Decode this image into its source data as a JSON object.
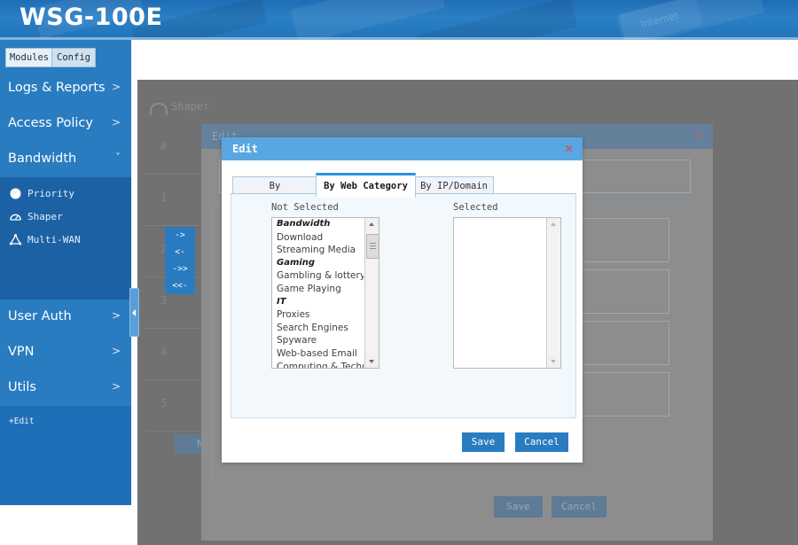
{
  "banner": {
    "product_title": "WSG-100E",
    "key_texture_label": "Internet"
  },
  "sidebar": {
    "tabs": [
      {
        "label": "Modules",
        "name": "tab-modules"
      },
      {
        "label": "Config",
        "name": "tab-config"
      }
    ],
    "items": [
      {
        "label": "Logs & Reports",
        "arrow": ">"
      },
      {
        "label": "Access Policy",
        "arrow": ">"
      },
      {
        "label": "Bandwidth",
        "arrow": "ˇ"
      },
      {
        "label": "User Auth",
        "arrow": ">"
      },
      {
        "label": "VPN",
        "arrow": ">"
      },
      {
        "label": "Utils",
        "arrow": ">"
      }
    ],
    "subitems": [
      {
        "label": "Priority",
        "icon": "circle-icon"
      },
      {
        "label": "Shaper",
        "icon": "gauge-icon"
      },
      {
        "label": "Multi-WAN",
        "icon": "network-triangle-icon"
      }
    ],
    "edit_link": "+Edit",
    "collapse_icon": "chevron-left-icon"
  },
  "background_page": {
    "title": "Shaper",
    "title_icon": "gauge-icon",
    "table_rows": [
      "#",
      "1",
      "2",
      "3",
      "4",
      "5"
    ],
    "new_button": "New"
  },
  "background_modal": {
    "title": "Edit",
    "close_icon": "close-icon",
    "save_label": "Save",
    "cancel_label": "Cancel"
  },
  "modal": {
    "title": "Edit",
    "close_icon": "close-icon",
    "tabs": [
      {
        "label": "By Applications",
        "active": false
      },
      {
        "label": "By Web Category",
        "active": true
      },
      {
        "label": "By IP/Domain",
        "active": false
      }
    ],
    "not_selected_label": "Not Selected",
    "selected_label": "Selected",
    "not_selected_items": [
      {
        "text": "Bandwidth",
        "group": true
      },
      {
        "text": "Download",
        "group": false
      },
      {
        "text": "Streaming Media",
        "group": false
      },
      {
        "text": "Gaming",
        "group": true
      },
      {
        "text": "Gambling & lottery",
        "group": false
      },
      {
        "text": "Game Playing",
        "group": false
      },
      {
        "text": "IT",
        "group": true
      },
      {
        "text": "Proxies",
        "group": false
      },
      {
        "text": "Search Engines",
        "group": false
      },
      {
        "text": "Spyware",
        "group": false
      },
      {
        "text": "Web-based Email",
        "group": false
      },
      {
        "text": "Computing & Technology",
        "group": false
      }
    ],
    "selected_items": [],
    "transfer_buttons": [
      {
        "label": "->",
        "name": "move-right-button"
      },
      {
        "label": "<-",
        "name": "move-left-button"
      },
      {
        "label": "->>",
        "name": "move-all-right-button"
      },
      {
        "label": "<<-",
        "name": "move-all-left-button"
      }
    ],
    "save_label": "Save",
    "cancel_label": "Cancel"
  },
  "colors": {
    "brand_blue": "#2a7cc0",
    "banner_blue": "#1f6db5",
    "modal_header_blue": "#58a7e0",
    "close_red": "#e8453c",
    "sidebar_sub_blue": "#1b61a4",
    "tab_accent": "#2f92dd"
  }
}
